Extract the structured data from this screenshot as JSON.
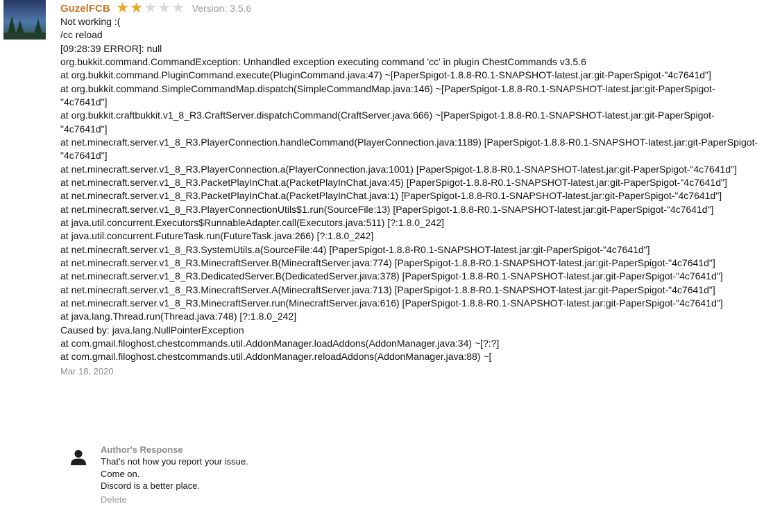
{
  "review": {
    "username": "GuzelFCB",
    "rating": 2,
    "rating_max": 5,
    "version": "Version: 3.5.6",
    "lines": [
      "Not working :(",
      "/cc reload",
      "[09:28:39 ERROR]: null",
      "org.bukkit.command.CommandException: Unhandled exception executing command 'cc' in plugin ChestCommands v3.5.6",
      "at org.bukkit.command.PluginCommand.execute(PluginCommand.java:47) ~[PaperSpigot-1.8.8-R0.1-SNAPSHOT-latest.jar:git-PaperSpigot-\"4c7641d\"]",
      "at org.bukkit.command.SimpleCommandMap.dispatch(SimpleCommandMap.java:146) ~[PaperSpigot-1.8.8-R0.1-SNAPSHOT-latest.jar:git-PaperSpigot-\"4c7641d\"]",
      "at org.bukkit.craftbukkit.v1_8_R3.CraftServer.dispatchCommand(CraftServer.java:666) ~[PaperSpigot-1.8.8-R0.1-SNAPSHOT-latest.jar:git-PaperSpigot-\"4c7641d\"]",
      "at net.minecraft.server.v1_8_R3.PlayerConnection.handleCommand(PlayerConnection.java:1189) [PaperSpigot-1.8.8-R0.1-SNAPSHOT-latest.jar:git-PaperSpigot-\"4c7641d\"]",
      "at net.minecraft.server.v1_8_R3.PlayerConnection.a(PlayerConnection.java:1001) [PaperSpigot-1.8.8-R0.1-SNAPSHOT-latest.jar:git-PaperSpigot-\"4c7641d\"]",
      "at net.minecraft.server.v1_8_R3.PacketPlayInChat.a(PacketPlayInChat.java:45) [PaperSpigot-1.8.8-R0.1-SNAPSHOT-latest.jar:git-PaperSpigot-\"4c7641d\"]",
      "at net.minecraft.server.v1_8_R3.PacketPlayInChat.a(PacketPlayInChat.java:1) [PaperSpigot-1.8.8-R0.1-SNAPSHOT-latest.jar:git-PaperSpigot-\"4c7641d\"]",
      "at net.minecraft.server.v1_8_R3.PlayerConnectionUtils$1.run(SourceFile:13) [PaperSpigot-1.8.8-R0.1-SNAPSHOT-latest.jar:git-PaperSpigot-\"4c7641d\"]",
      "at java.util.concurrent.Executors$RunnableAdapter.call(Executors.java:511) [?:1.8.0_242]",
      "at java.util.concurrent.FutureTask.run(FutureTask.java:266) [?:1.8.0_242]",
      "at net.minecraft.server.v1_8_R3.SystemUtils.a(SourceFile:44) [PaperSpigot-1.8.8-R0.1-SNAPSHOT-latest.jar:git-PaperSpigot-\"4c7641d\"]",
      "at net.minecraft.server.v1_8_R3.MinecraftServer.B(MinecraftServer.java:774) [PaperSpigot-1.8.8-R0.1-SNAPSHOT-latest.jar:git-PaperSpigot-\"4c7641d\"]",
      "at net.minecraft.server.v1_8_R3.DedicatedServer.B(DedicatedServer.java:378) [PaperSpigot-1.8.8-R0.1-SNAPSHOT-latest.jar:git-PaperSpigot-\"4c7641d\"]",
      "at net.minecraft.server.v1_8_R3.MinecraftServer.A(MinecraftServer.java:713) [PaperSpigot-1.8.8-R0.1-SNAPSHOT-latest.jar:git-PaperSpigot-\"4c7641d\"]",
      "at net.minecraft.server.v1_8_R3.MinecraftServer.run(MinecraftServer.java:616) [PaperSpigot-1.8.8-R0.1-SNAPSHOT-latest.jar:git-PaperSpigot-\"4c7641d\"]",
      "at java.lang.Thread.run(Thread.java:748) [?:1.8.0_242]",
      "Caused by: java.lang.NullPointerException",
      "at com.gmail.filoghost.chestcommands.util.AddonManager.loadAddons(AddonManager.java:34) ~[?:?]",
      "at com.gmail.filoghost.chestcommands.util.AddonManager.reloadAddons(AddonManager.java:88) ~["
    ],
    "date": "Mar 18, 2020"
  },
  "author_response": {
    "title": "Author's Response",
    "lines": [
      "That's not how you report your issue.",
      "Come on.",
      "Discord is a better place."
    ],
    "delete_label": "Delete"
  },
  "colors": {
    "username": "#c6782a",
    "star_on": "#e5a81e",
    "star_off": "#d8d8d8"
  }
}
